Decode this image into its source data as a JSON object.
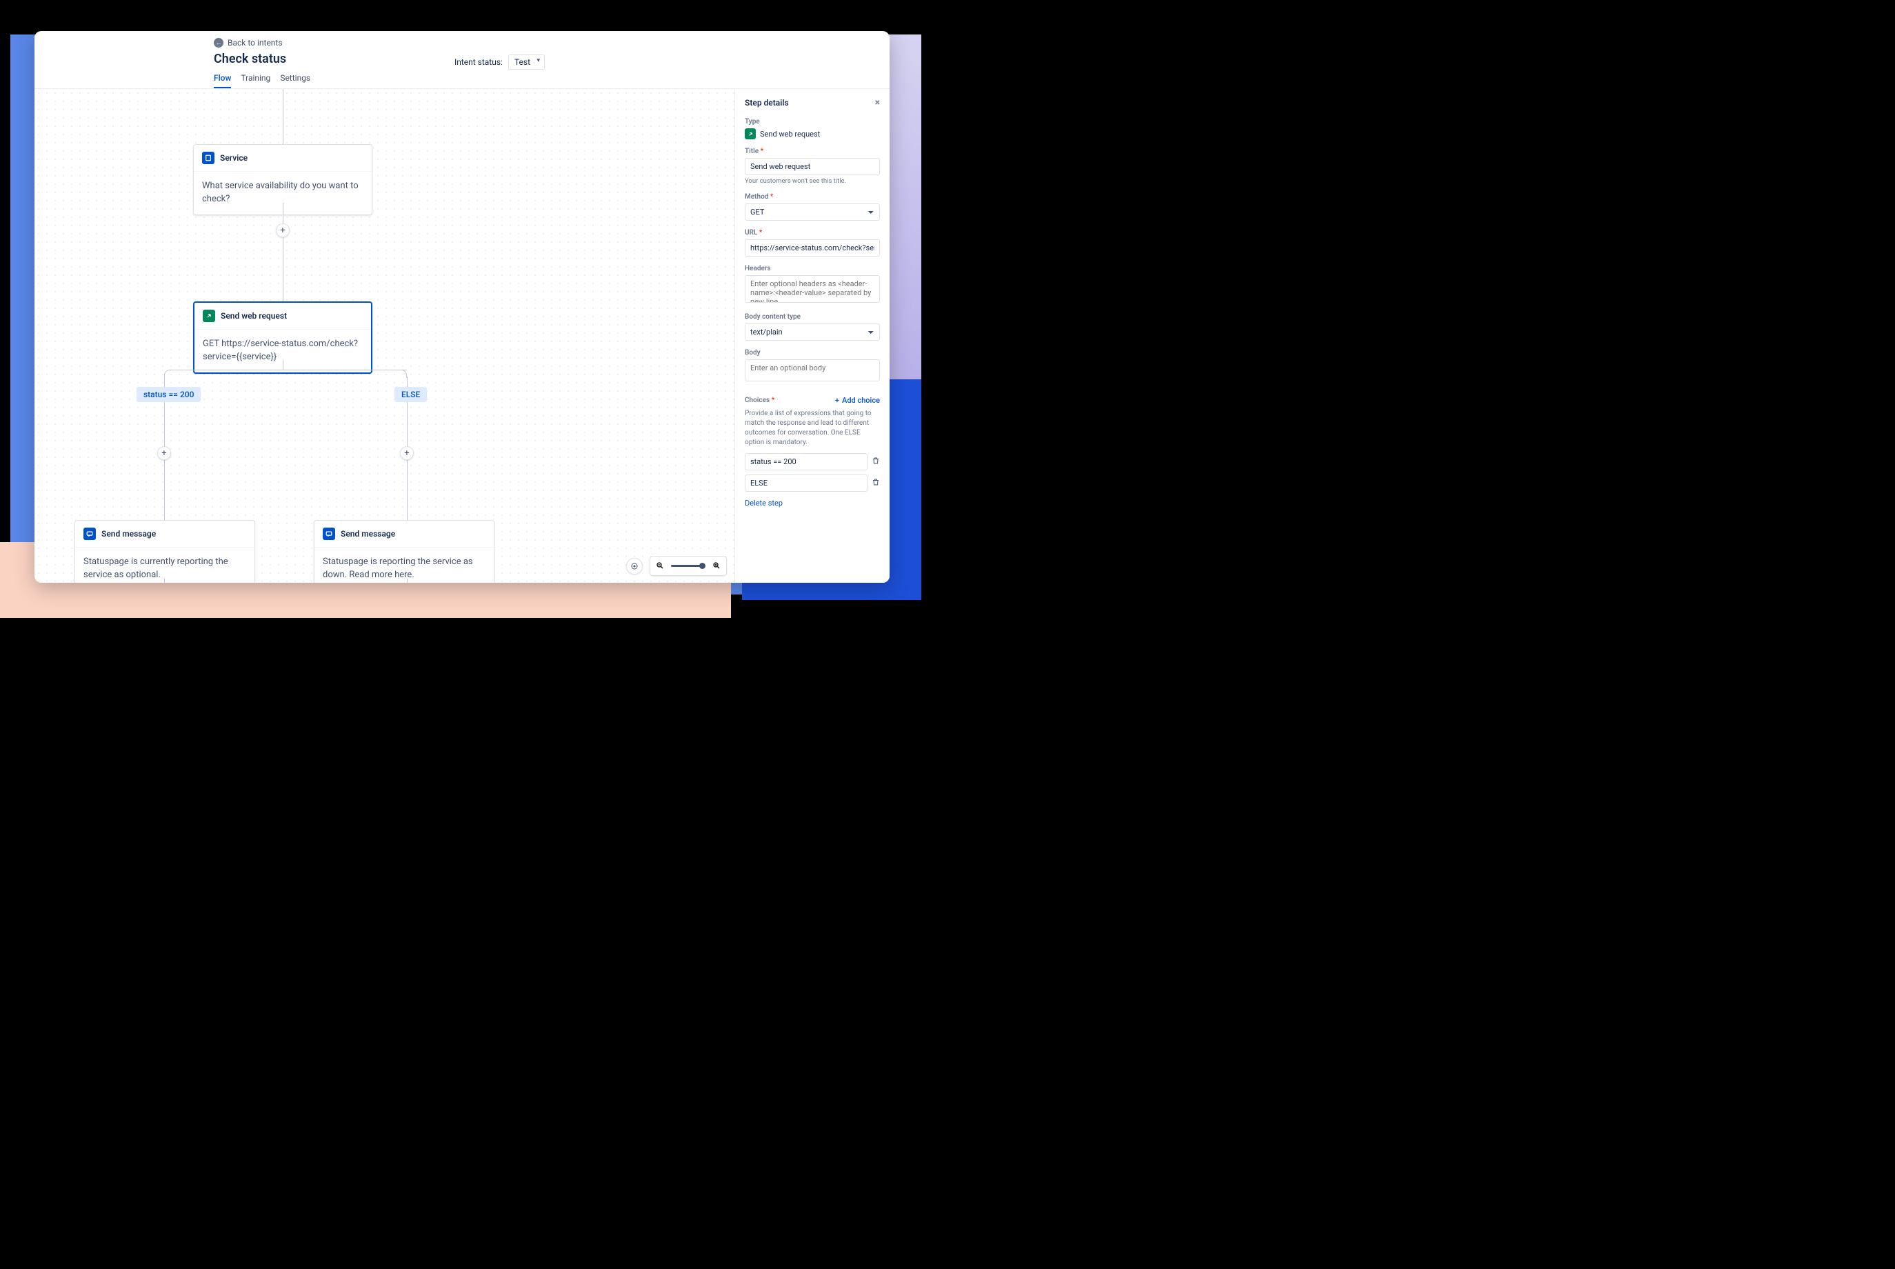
{
  "header": {
    "back_label": "Back to intents",
    "title": "Check status",
    "intent_status_label": "Intent status:",
    "intent_status_value": "Test",
    "tabs": {
      "flow": "Flow",
      "training": "Training",
      "settings": "Settings"
    }
  },
  "canvas": {
    "node_service": {
      "title": "Service",
      "body": "What service availability do you want to check?"
    },
    "node_webreq": {
      "title": "Send web request",
      "body": "GET https://service-status.com/check?service={{service}}"
    },
    "branch_status": "status == 200",
    "branch_else": "ELSE",
    "node_msg_left": {
      "title": "Send message",
      "body": "Statuspage is currently reporting the service as optional."
    },
    "node_msg_right": {
      "title": "Send message",
      "body": "Statuspage is reporting the service as down. Read more here."
    }
  },
  "panel": {
    "header": "Step details",
    "type_label": "Type",
    "type_value": "Send web request",
    "title_label": "Title",
    "title_value": "Send web request",
    "title_hint": "Your customers won't see this title.",
    "method_label": "Method",
    "method_value": "GET",
    "url_label": "URL",
    "url_value": "https://service-status.com/check?service={{service}}",
    "headers_label": "Headers",
    "headers_placeholder": "Enter optional headers as <header-name>:<header-value> separated by new line",
    "bodytype_label": "Body content type",
    "bodytype_value": "text/plain",
    "body_label": "Body",
    "body_placeholder": "Enter an optional body",
    "choices_label": "Choices",
    "add_choice_label": "Add choice",
    "choices_desc": "Provide a list of expressions that going to match the response and lead to different outcomes for conversation. One ELSE option is mandatory.",
    "choice_1": "status == 200",
    "choice_2": "ELSE",
    "delete_step": "Delete step"
  }
}
